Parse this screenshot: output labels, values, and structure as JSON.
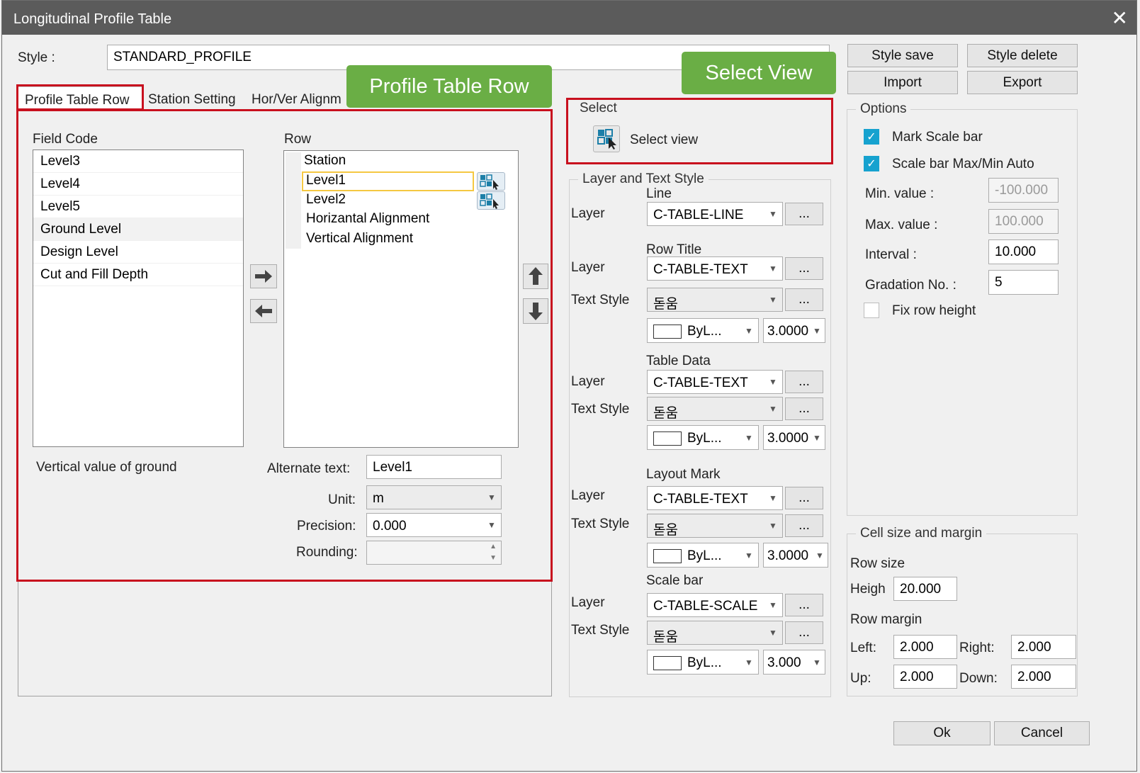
{
  "window": {
    "title": "Longitudinal Profile Table",
    "close": "✕"
  },
  "style": {
    "label": "Style :",
    "value": "STANDARD_PROFILE"
  },
  "topButtons": {
    "save": "Style save",
    "delete": "Style delete",
    "import": "Import",
    "export": "Export"
  },
  "tabs": [
    "Profile Table Row",
    "Station Setting",
    "Hor/Ver Alignm"
  ],
  "callouts": {
    "profileRow": "Profile Table Row",
    "selectView": "Select View"
  },
  "fieldCode": {
    "label": "Field Code",
    "items": [
      "Level3",
      "Level4",
      "Level5",
      "Ground Level",
      "Design Level",
      "Cut and Fill Depth"
    ],
    "description": "Vertical value of ground"
  },
  "row": {
    "label": "Row",
    "items": [
      "Station",
      "Level1",
      "Level2",
      "Horizantal Alignment",
      "Vertical Alignment"
    ]
  },
  "rowProps": {
    "altLabel": "Alternate text:",
    "altValue": "Level1",
    "unitLabel": "Unit:",
    "unitValue": "m",
    "precisionLabel": "Precision:",
    "precisionValue": "0.000",
    "roundingLabel": "Rounding:"
  },
  "select": {
    "group": "Select",
    "button": "Select view"
  },
  "layerText": {
    "group": "Layer and Text Style",
    "layerLabel": "Layer",
    "textStyleLabel": "Text Style",
    "more": "...",
    "line": {
      "title": "Line",
      "layer": "C-TABLE-LINE"
    },
    "rowTitle": {
      "title": "Row Title",
      "layer": "C-TABLE-TEXT",
      "font": "돋움",
      "color": "ByL...",
      "height": "3.0000"
    },
    "tableData": {
      "title": "Table Data",
      "layer": "C-TABLE-TEXT",
      "font": "돋움",
      "color": "ByL...",
      "height": "3.0000"
    },
    "layoutMark": {
      "title": "Layout Mark",
      "layer": "C-TABLE-TEXT",
      "font": "돋움",
      "color": "ByL...",
      "height": "3.0000"
    },
    "scaleBar": {
      "title": "Scale bar",
      "layer": "C-TABLE-SCALE",
      "font": "돋움",
      "color": "ByL...",
      "height": "3.000"
    }
  },
  "options": {
    "group": "Options",
    "markScale": "Mark Scale bar",
    "scaleAuto": "Scale bar Max/Min Auto",
    "minLabel": "Min. value :",
    "minValue": "-100.000",
    "maxLabel": "Max. value :",
    "maxValue": "100.000",
    "intervalLabel": "Interval :",
    "intervalValue": "10.000",
    "gradLabel": "Gradation No. :",
    "gradValue": "5",
    "fixRow": "Fix row height"
  },
  "cell": {
    "group": "Cell size and margin",
    "rowSize": "Row size",
    "heightLabel": "Heigh",
    "heightValue": "20.000",
    "rowMargin": "Row margin",
    "leftLabel": "Left:",
    "leftValue": "2.000",
    "rightLabel": "Right:",
    "rightValue": "2.000",
    "upLabel": "Up:",
    "upValue": "2.000",
    "downLabel": "Down:",
    "downValue": "2.000"
  },
  "footer": {
    "ok": "Ok",
    "cancel": "Cancel"
  }
}
